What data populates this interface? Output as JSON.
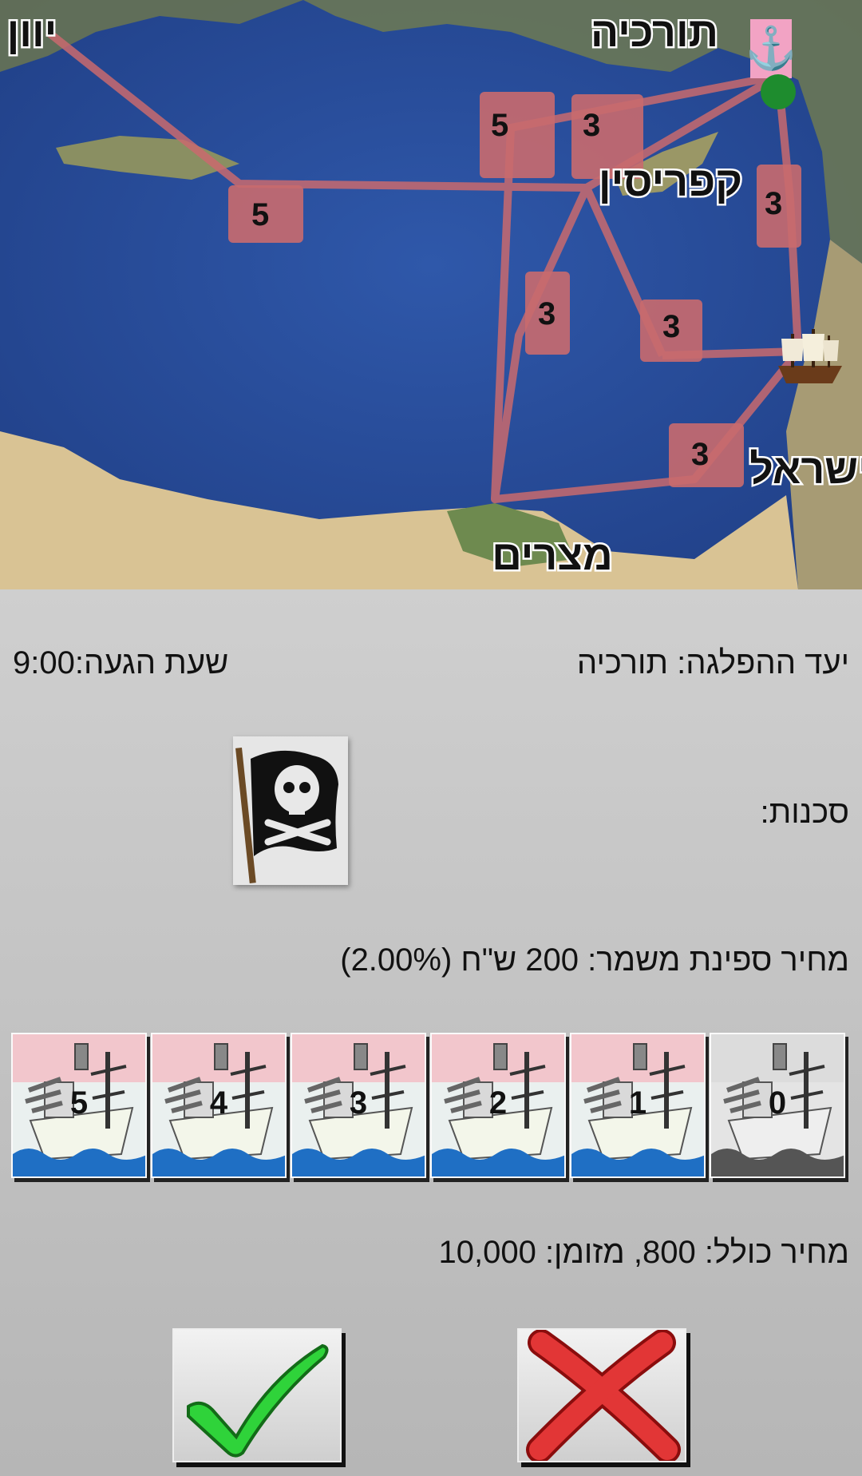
{
  "map": {
    "places": {
      "greece": "יוון",
      "turkey": "תורכיה",
      "cyprus": "קפריסין",
      "israel": "ישראל",
      "egypt": "מצרים"
    },
    "route_risks": [
      "5",
      "5",
      "3",
      "3",
      "3",
      "3",
      "3"
    ],
    "colors": {
      "sea": "#2b4f9e",
      "land": "#d8c59a",
      "route": "#c96a6e"
    }
  },
  "details": {
    "destination": "יעד ההפלגה: תורכיה",
    "arrival": "שעת הגעה:9:00",
    "dangers_label": "סכנות:",
    "danger_icon": "pirate-flag",
    "guard_price": "מחיר ספינת משמר: 200 ש\"ח (2.00%)",
    "total": "מחיר כולל: 800, מזומן: 10,000"
  },
  "escorts": [
    {
      "label": "5"
    },
    {
      "label": "4"
    },
    {
      "label": "3"
    },
    {
      "label": "2"
    },
    {
      "label": "1"
    },
    {
      "label": "0"
    }
  ],
  "buttons": {
    "confirm": "confirm-check",
    "cancel": "cancel-x"
  }
}
